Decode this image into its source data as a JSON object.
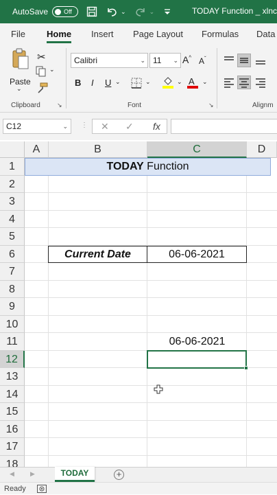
{
  "titlebar": {
    "autosave_label": "AutoSave",
    "autosave_state": "Off",
    "document_title": "TODAY Function _ xlnc"
  },
  "tabs": [
    {
      "label": "File"
    },
    {
      "label": "Home"
    },
    {
      "label": "Insert"
    },
    {
      "label": "Page Layout"
    },
    {
      "label": "Formulas"
    },
    {
      "label": "Data"
    }
  ],
  "ribbon": {
    "paste_label": "Paste",
    "font_name": "Calibri",
    "font_size": "11",
    "bold": "B",
    "italic": "I",
    "underline": "U",
    "groups": {
      "clipboard": "Clipboard",
      "font": "Font",
      "alignment": "Alignm"
    }
  },
  "formula_bar": {
    "name_box": "C12",
    "cancel": "✕",
    "enter": "✓",
    "fx": "fx",
    "value": ""
  },
  "columns": [
    "A",
    "B",
    "C",
    "D"
  ],
  "rows": [
    "1",
    "2",
    "3",
    "4",
    "5",
    "6",
    "7",
    "8",
    "9",
    "10",
    "11",
    "12",
    "13",
    "14",
    "15",
    "16",
    "17",
    "18"
  ],
  "cells": {
    "title_bold": "TODAY",
    "title_rest": " Function",
    "label": "Current Date",
    "value": "06-06-2021",
    "c11": "06-06-2021"
  },
  "sheets": [
    {
      "name": "TODAY"
    }
  ],
  "status": {
    "text": "Ready"
  },
  "colors": {
    "accent": "#217346",
    "header_fill": "#dbe5f5"
  }
}
